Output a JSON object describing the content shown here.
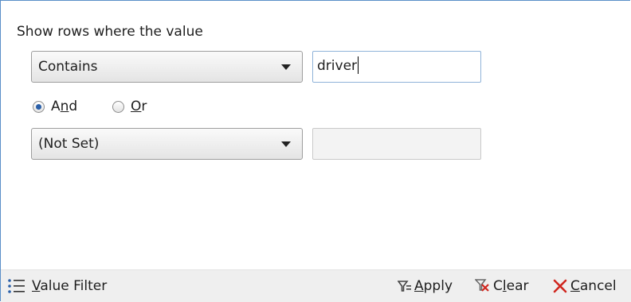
{
  "header": {
    "title": "Show rows where the value"
  },
  "condition1": {
    "operator": "Contains",
    "value": "driver"
  },
  "logic": {
    "options": [
      {
        "label_pre": "A",
        "label_access": "n",
        "label_post": "d",
        "checked": true
      },
      {
        "label_pre": "",
        "label_access": "O",
        "label_post": "r",
        "checked": false
      }
    ]
  },
  "condition2": {
    "operator": "(Not Set)",
    "value": ""
  },
  "footer": {
    "filter_mode_pre": "",
    "filter_mode_access": "V",
    "filter_mode_post": "alue Filter",
    "apply_pre": "",
    "apply_access": "A",
    "apply_post": "pply",
    "clear_pre": "C",
    "clear_access": "l",
    "clear_post": "ear",
    "cancel_pre": "",
    "cancel_access": "C",
    "cancel_post": "ancel"
  },
  "colors": {
    "panel_border": "#5a8fc8",
    "textbox_border": "#8fb3d9",
    "radio_checked": "#2a5fa8",
    "cancel_icon": "#d0271f",
    "filter_icon": "#444444",
    "footer_bg": "#efefef"
  },
  "icons": {
    "filter_mode": "list-icon",
    "apply": "funnel-apply-icon",
    "clear": "funnel-clear-icon",
    "cancel": "close-x-icon"
  }
}
